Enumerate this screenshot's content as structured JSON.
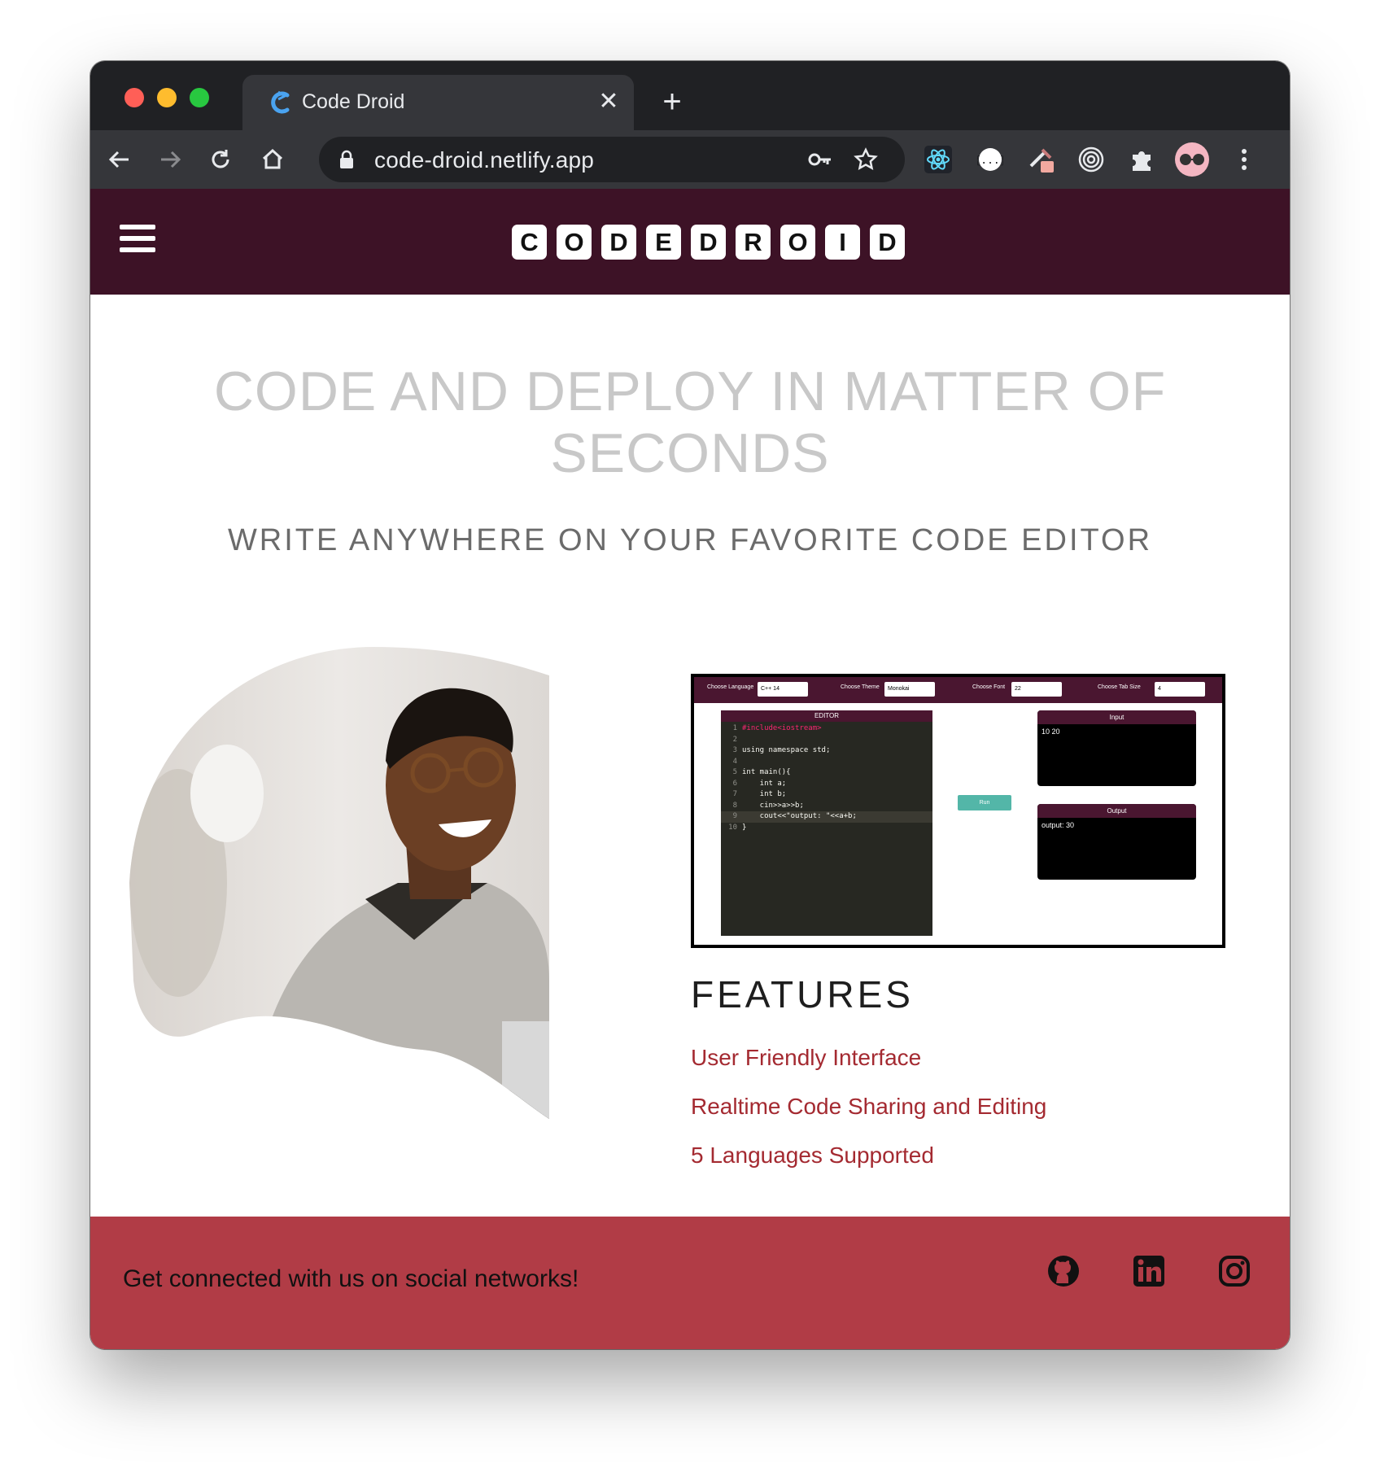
{
  "browser": {
    "tab_title": "Code Droid",
    "tab_close": "✕",
    "new_tab": "+",
    "url": "code-droid.netlify.app"
  },
  "header": {
    "logo_letters": [
      "C",
      "O",
      "D",
      "E",
      "D",
      "R",
      "O",
      "I",
      "D"
    ],
    "bg_color": "#3d1226"
  },
  "hero": {
    "title": "CODE AND DEPLOY IN MATTER OF SECONDS",
    "subtitle": "WRITE ANYWHERE ON YOUR FAVORITE CODE EDITOR"
  },
  "screenshot": {
    "controls": [
      {
        "label": "Choose Language",
        "value": "C++ 14"
      },
      {
        "label": "Choose Theme",
        "value": "Monokai"
      },
      {
        "label": "Choose Font",
        "value": "22"
      },
      {
        "label": "Choose Tab Size",
        "value": "4"
      }
    ],
    "editor_title": "EDITOR",
    "code_lines": [
      {
        "n": "1",
        "text": "#include<iostream>"
      },
      {
        "n": "2",
        "text": ""
      },
      {
        "n": "3",
        "text": "using namespace std;"
      },
      {
        "n": "4",
        "text": ""
      },
      {
        "n": "5",
        "text": "int main(){"
      },
      {
        "n": "6",
        "text": "    int a;"
      },
      {
        "n": "7",
        "text": "    int b;"
      },
      {
        "n": "8",
        "text": "    cin>>a>>b;"
      },
      {
        "n": "9",
        "text": "    cout<<\"output: \"<<a+b;"
      },
      {
        "n": "10",
        "text": "}"
      }
    ],
    "run_label": "Run",
    "input_title": "Input",
    "input_value": "10 20",
    "output_title": "Output",
    "output_value": "output: 30"
  },
  "features": {
    "title": "FEATURES",
    "items": [
      "User Friendly Interface",
      "Realtime Code Sharing and Editing",
      "5 Languages Supported"
    ],
    "color": "#a42a31"
  },
  "footer": {
    "text": "Get connected with us on social networks!",
    "icons": [
      "github-icon",
      "linkedin-icon",
      "instagram-icon"
    ],
    "bg_color": "#b13c46"
  }
}
